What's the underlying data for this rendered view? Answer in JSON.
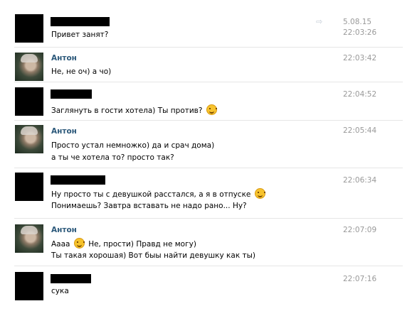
{
  "dialog": {
    "date": "5.08.15",
    "messages": [
      {
        "author": "",
        "time": "22:03:26",
        "lines": [
          "Привет занят?"
        ]
      },
      {
        "author": "Антон",
        "time": "22:03:42",
        "lines": [
          "Не, не оч) а чо)"
        ]
      },
      {
        "author": "",
        "time": "22:04:52",
        "lines": [
          "Заглянуть в гости хотела) Ты против?"
        ]
      },
      {
        "author": "Антон",
        "time": "22:05:44",
        "lines": [
          "Просто устал немножко) да и срач дома)",
          "а ты че хотела то? просто так?"
        ]
      },
      {
        "author": "",
        "time": "22:06:34",
        "lines": [
          "Ну просто ты с девушкой расстался, а я в отпуске",
          "Понимаешь? Завтра вставать не надо рано... Ну?"
        ]
      },
      {
        "author": "Антон",
        "time": "22:07:09",
        "lines_parts": [
          "Аааа",
          "Не, прости) Правд не могу)"
        ],
        "lines": [
          "Ты такая хорошая) Вот быы найти девушку как ты)"
        ]
      },
      {
        "author": "",
        "time": "22:07:16",
        "lines": [
          "сука"
        ]
      }
    ]
  },
  "icons": {
    "forward": "forward-arrow-icon",
    "emoji": "smile-emoji-icon"
  }
}
